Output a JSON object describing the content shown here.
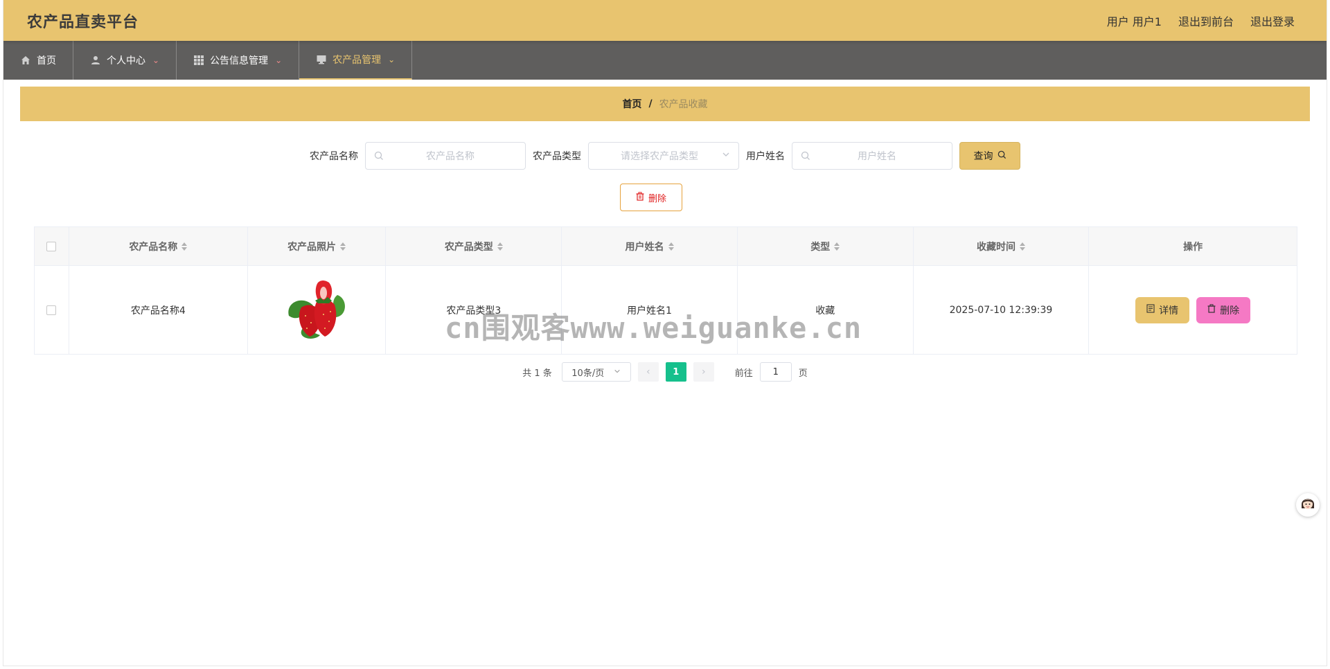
{
  "header": {
    "title": "农产品直卖平台",
    "user_label": "用户 用户1",
    "front_label": "退出到前台",
    "logout_label": "退出登录"
  },
  "nav": {
    "items": [
      {
        "label": "首页",
        "icon": "home-icon"
      },
      {
        "label": "个人中心",
        "icon": "user-icon"
      },
      {
        "label": "公告信息管理",
        "icon": "grid-icon"
      },
      {
        "label": "农产品管理",
        "icon": "monitor-icon"
      }
    ]
  },
  "breadcrumb": {
    "home": "首页",
    "sep": "/",
    "current": "农产品收藏"
  },
  "search": {
    "name_label": "农产品名称",
    "name_placeholder": "农产品名称",
    "type_label": "农产品类型",
    "type_placeholder": "请选择农产品类型",
    "user_label": "用户姓名",
    "user_placeholder": "用户姓名",
    "query_label": "查询"
  },
  "bulk_delete_label": "删除",
  "table": {
    "headers": [
      "农产品名称",
      "农产品照片",
      "农产品类型",
      "用户姓名",
      "类型",
      "收藏时间",
      "操作"
    ],
    "rows": [
      {
        "name": "农产品名称4",
        "type": "农产品类型3",
        "user": "用户姓名1",
        "kind": "收藏",
        "time": "2025-07-10 12:39:39",
        "detail_label": "详情",
        "delete_label": "删除"
      }
    ]
  },
  "pagination": {
    "total": "共 1 条",
    "page_size": "10条/页",
    "current_page": "1",
    "goto_label": "前往",
    "goto_value": "1",
    "page_unit": "页"
  },
  "watermark": "cn围观客www.weiguanke.cn",
  "colors": {
    "accent": "#e8c46f",
    "nav_bg": "#5f5e5d",
    "danger_btn": "#f579c4",
    "page_active": "#16c08c"
  }
}
